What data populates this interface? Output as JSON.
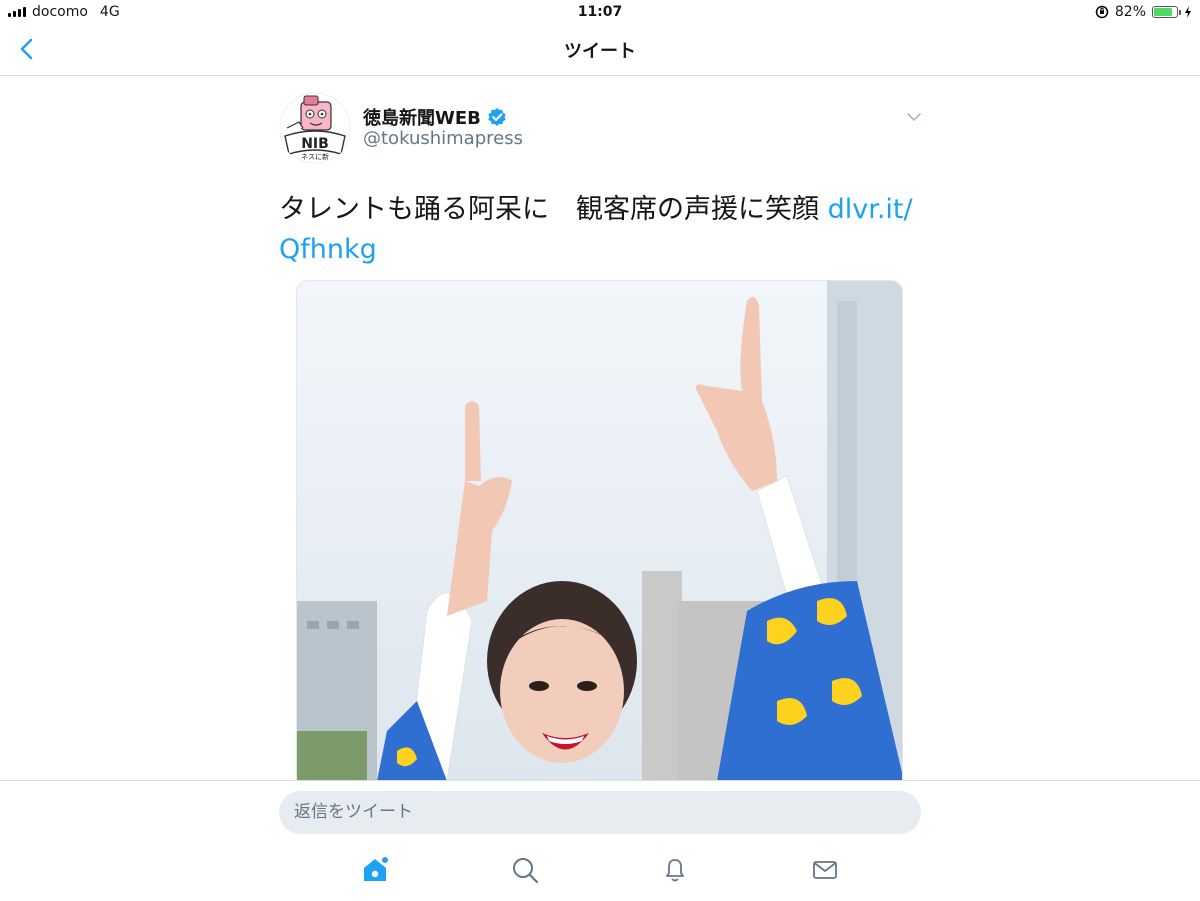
{
  "status_bar": {
    "carrier": "docomo",
    "network": "4G",
    "time": "11:07",
    "battery_percent": "82%",
    "battery_level": 0.82
  },
  "nav": {
    "title": "ツイート",
    "back_icon": "chevron-left-icon"
  },
  "tweet": {
    "avatar_text": "NIB",
    "avatar_subtext": "ネスに新",
    "display_name": "徳島新聞WEB",
    "handle": "@tokushimapress",
    "verified": true,
    "text": "タレントも踊る阿呆に　観客席の声援に笑顔 ",
    "link_line1": "dlvr.it/",
    "link_line2": "Qfhnkg"
  },
  "reply_bar": {
    "placeholder": "返信をツイート"
  },
  "tab_bar": {
    "items": [
      "home-icon",
      "search-icon",
      "bell-icon",
      "mail-icon"
    ]
  },
  "colors": {
    "accent": "#1da1f2",
    "secondary_text": "#657786",
    "divider": "#dfe2e5",
    "reply_field": "#e6ecf0"
  }
}
